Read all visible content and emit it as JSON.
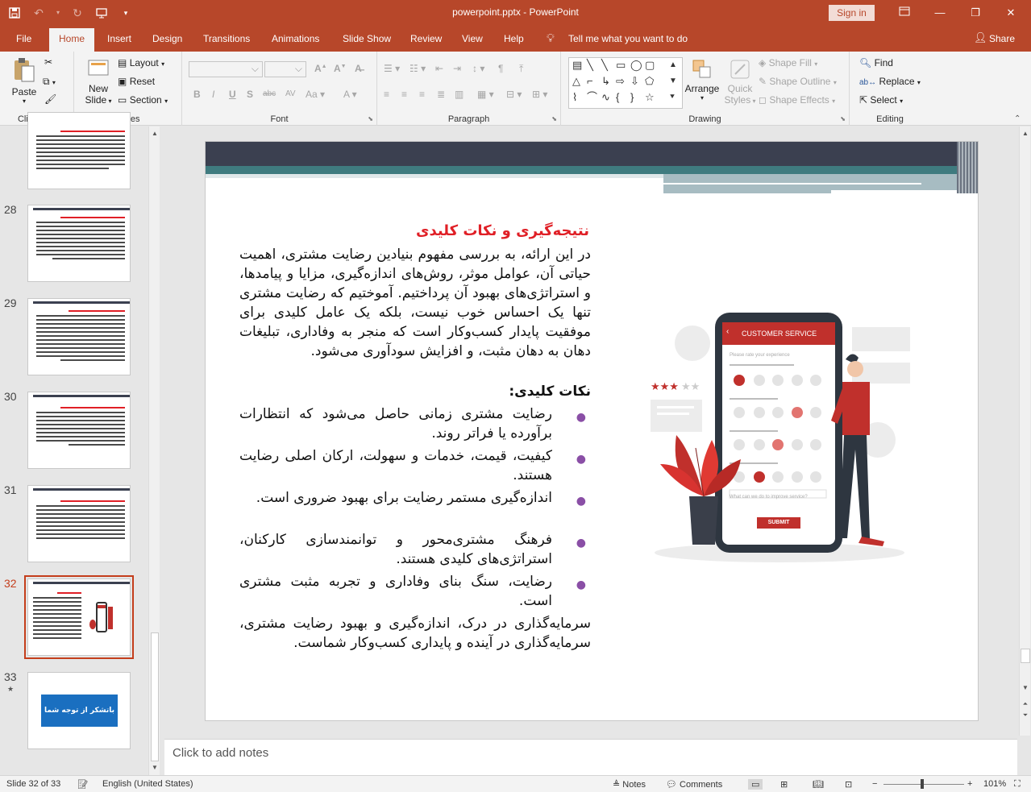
{
  "window": {
    "doc_title": "powerpoint.pptx  -  PowerPoint",
    "sign_in": "Sign in"
  },
  "tabs": [
    {
      "label": "File"
    },
    {
      "label": "Home"
    },
    {
      "label": "Insert"
    },
    {
      "label": "Design"
    },
    {
      "label": "Transitions"
    },
    {
      "label": "Animations"
    },
    {
      "label": "Slide Show"
    },
    {
      "label": "Review"
    },
    {
      "label": "View"
    },
    {
      "label": "Help"
    }
  ],
  "tell_me": "Tell me what you want to do",
  "share": "Share",
  "ribbon": {
    "clipboard": {
      "label": "Clipboard",
      "paste": "Paste"
    },
    "slides": {
      "label": "Slides",
      "new_slide_1": "New",
      "new_slide_2": "Slide",
      "layout": "Layout",
      "reset": "Reset",
      "section": "Section"
    },
    "font": {
      "label": "Font"
    },
    "paragraph": {
      "label": "Paragraph"
    },
    "drawing": {
      "label": "Drawing",
      "arrange": "Arrange",
      "quick_styles_1": "Quick",
      "quick_styles_2": "Styles",
      "shape_fill": "Shape Fill",
      "shape_outline": "Shape Outline",
      "shape_effects": "Shape Effects"
    },
    "editing": {
      "label": "Editing",
      "find": "Find",
      "replace": "Replace",
      "select": "Select"
    }
  },
  "thumbnails": [
    {
      "num": ""
    },
    {
      "num": "28"
    },
    {
      "num": "29"
    },
    {
      "num": "30"
    },
    {
      "num": "31"
    },
    {
      "num": "32"
    },
    {
      "num": "33",
      "text": "باتشکر از توجه شما"
    }
  ],
  "slide": {
    "title": "نتیجه‌گیری و نکات کلیدی",
    "intro": "در این ارائه، به بررسی مفهوم بنیادین رضایت مشتری، اهمیت حیاتی آن، عوامل موثر، روش‌های اندازه‌گیری، مزایا و پیامدها، و استراتژی‌های بهبود آن پرداختیم. آموختیم که رضایت مشتری تنها یک احساس خوب نیست، بلکه یک عامل کلیدی برای موفقیت پایدار کسب‌وکار است که منجر به وفاداری، تبلیغات دهان به دهان مثبت، و افزایش سودآوری می‌شود.",
    "subheading": "نکات کلیدی:",
    "bullets": [
      "رضایت مشتری زمانی حاصل می‌شود که انتظارات برآورده یا فراتر روند.",
      "کیفیت، قیمت، خدمات و سهولت، ارکان اصلی رضایت هستند.",
      "اندازه‌گیری مستمر رضایت برای بهبود ضروری است.",
      "فرهنگ مشتری‌محور و توانمندسازی کارکنان، استراتژی‌های کلیدی هستند.",
      "رضایت، سنگ بنای وفاداری و تجربه مثبت مشتری است."
    ],
    "conclusion": "سرمایه‌گذاری در درک، اندازه‌گیری و بهبود رضایت مشتری، سرمایه‌گذاری در آینده و پایداری کسب‌وکار شماست.",
    "phone": {
      "header": "CUSTOMER SERVICE",
      "rate_prompt": "Please rate your experience",
      "improve_prompt": "What can we do to improve service?",
      "submit": "SUBMIT"
    }
  },
  "notes": {
    "placeholder": "Click to add notes"
  },
  "status": {
    "slide_info": "Slide 32 of 33",
    "language": "English (United States)",
    "notes": "Notes",
    "comments": "Comments",
    "zoom": "101%"
  },
  "colors": {
    "accent": "#b7472a",
    "title_red": "#e01f26",
    "banner_dark": "#3b4050",
    "banner_teal": "#3f7b7f"
  }
}
